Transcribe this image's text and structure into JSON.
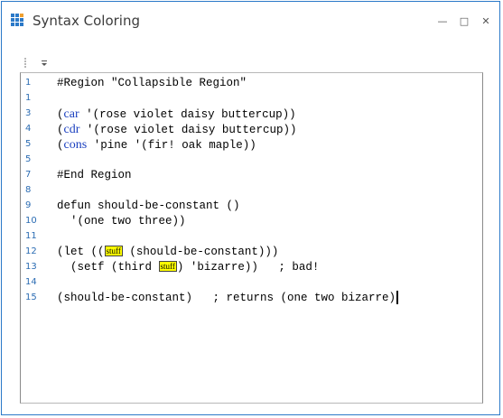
{
  "window": {
    "title": "Syntax Coloring",
    "controls": {
      "minimize": "—",
      "maximize": "□",
      "close": "✕"
    },
    "colors": {
      "border": "#2b79c8",
      "keyword": "#1a3fbf",
      "highlight": "#ffff00",
      "line_number": "#2b6cb3"
    }
  },
  "toolbar": {
    "overflow_icon": "chevron-down-icon"
  },
  "editor": {
    "lines": [
      {
        "num": "1",
        "parts": [
          {
            "t": "#Region \"Collapsible Region\""
          }
        ]
      },
      {
        "num": "1",
        "parts": []
      },
      {
        "num": "3",
        "parts": [
          {
            "t": "("
          },
          {
            "t": "car",
            "c": "kw"
          },
          {
            "t": " '(rose violet daisy buttercup))"
          }
        ]
      },
      {
        "num": "4",
        "parts": [
          {
            "t": "("
          },
          {
            "t": "cdr",
            "c": "kw"
          },
          {
            "t": " '(rose violet daisy buttercup))"
          }
        ]
      },
      {
        "num": "5",
        "parts": [
          {
            "t": "("
          },
          {
            "t": "cons",
            "c": "kw"
          },
          {
            "t": " 'pine '(fir! oak maple))"
          }
        ]
      },
      {
        "num": "5",
        "parts": []
      },
      {
        "num": "7",
        "parts": [
          {
            "t": "#End Region"
          }
        ]
      },
      {
        "num": "8",
        "parts": []
      },
      {
        "num": "9",
        "parts": [
          {
            "t": "defun should-be-constant ()"
          }
        ]
      },
      {
        "num": "10",
        "parts": [
          {
            "t": "  '(one two three))"
          }
        ]
      },
      {
        "num": "11",
        "parts": []
      },
      {
        "num": "12",
        "parts": [
          {
            "t": "(let (("
          },
          {
            "t": "stuff",
            "c": "hl"
          },
          {
            "t": " (should-be-constant)))"
          }
        ]
      },
      {
        "num": "13",
        "parts": [
          {
            "t": "  (setf (third "
          },
          {
            "t": "stuff",
            "c": "hl"
          },
          {
            "t": ") 'bizarre))   ; bad!"
          }
        ]
      },
      {
        "num": "14",
        "parts": []
      },
      {
        "num": "15",
        "parts": [
          {
            "t": "(should-be-constant)   ; returns (one two bizarre)"
          },
          {
            "caret": true
          }
        ]
      }
    ]
  }
}
